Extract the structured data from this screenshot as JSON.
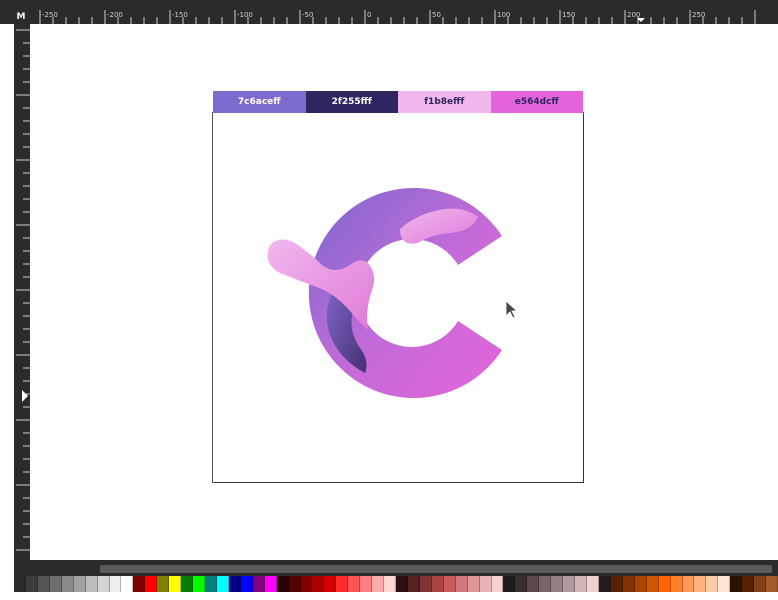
{
  "ruler": {
    "corner_glyph": "M",
    "labels": [
      "-250",
      "-200",
      "-150",
      "-100",
      "-50",
      "0",
      "50",
      "100",
      "150",
      "200",
      "250"
    ]
  },
  "swatches": [
    {
      "label": "7c6aceff",
      "color": "#7c6ace",
      "text_color": "#ffffff"
    },
    {
      "label": "2f255fff",
      "color": "#2f255f",
      "text_color": "#ffffff"
    },
    {
      "label": "f1b8efff",
      "color": "#f1b8ef",
      "text_color": "#2f255f"
    },
    {
      "label": "e564dcff",
      "color": "#e564dc",
      "text_color": "#2f255f"
    }
  ],
  "palette_colors": [
    "#2b2b2b",
    "#3c3c3c",
    "#555555",
    "#6e6e6e",
    "#888888",
    "#a1a1a1",
    "#bbbbbb",
    "#d4d4d4",
    "#eeeeee",
    "#ffffff",
    "#7f0000",
    "#ff0000",
    "#808000",
    "#ffff00",
    "#008000",
    "#00ff00",
    "#008080",
    "#00ffff",
    "#000080",
    "#0000ff",
    "#800080",
    "#ff00ff",
    "#2b0000",
    "#550000",
    "#800000",
    "#aa0000",
    "#d40000",
    "#ff2a2a",
    "#ff5555",
    "#ff8080",
    "#ffaaaa",
    "#ffd5d5",
    "#2b1111",
    "#552222",
    "#803333",
    "#aa4444",
    "#c85a5a",
    "#d37878",
    "#de9696",
    "#e9b4b4",
    "#f4d2d2",
    "#1c1c1c",
    "#3a2f2f",
    "#5a4a4a",
    "#786565",
    "#968080",
    "#b49b9b",
    "#d2b6b6",
    "#eed2d2",
    "#241c1c",
    "#552200",
    "#803300",
    "#aa4400",
    "#d45500",
    "#ff6600",
    "#ff7f2a",
    "#ff9955",
    "#ffb380",
    "#ffccaa",
    "#ffe6d5",
    "#2b1100",
    "#552200",
    "#804015",
    "#a05a2c"
  ],
  "accent": "#7c6ace"
}
